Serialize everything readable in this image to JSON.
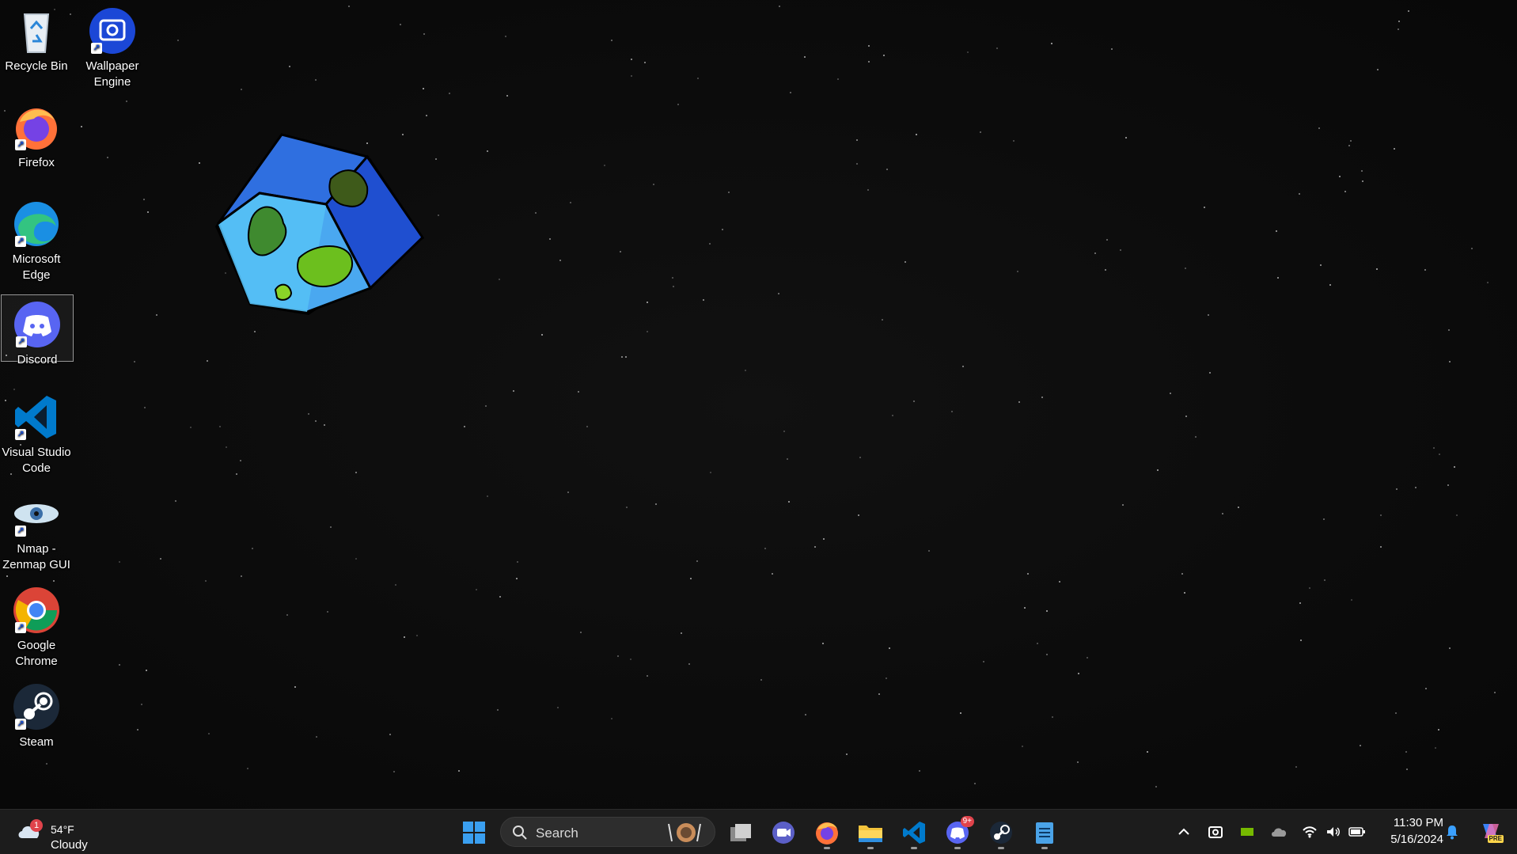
{
  "desktop": {
    "icons": [
      {
        "label": "Recycle Bin",
        "icon": "recycle-bin-icon"
      },
      {
        "label": "Wallpaper Engine",
        "icon": "wallpaper-engine-icon"
      },
      {
        "label": "Firefox",
        "icon": "firefox-icon"
      },
      {
        "label": "Microsoft Edge",
        "icon": "edge-icon"
      },
      {
        "label": "Discord",
        "icon": "discord-icon"
      },
      {
        "label": "Visual Studio Code",
        "icon": "vscode-icon"
      },
      {
        "label": "Nmap - Zenmap GUI",
        "icon": "zenmap-icon"
      },
      {
        "label": "Google Chrome",
        "icon": "chrome-icon"
      },
      {
        "label": "Steam",
        "icon": "steam-icon"
      }
    ],
    "selected_icon": "Discord",
    "wallpaper": "starfield with cube-shaped planet"
  },
  "taskbar": {
    "weather": {
      "temp": "54°F",
      "condition": "Cloudy",
      "badge": "1"
    },
    "search": {
      "placeholder": "Search"
    },
    "pinned": [
      {
        "name": "start",
        "icon": "windows-logo-icon"
      },
      {
        "name": "task-view",
        "icon": "task-view-icon"
      },
      {
        "name": "teams-meet",
        "icon": "camera-chat-icon"
      },
      {
        "name": "firefox",
        "icon": "firefox-icon",
        "running": true
      },
      {
        "name": "file-explorer",
        "icon": "folder-icon",
        "running": true
      },
      {
        "name": "vscode",
        "icon": "vscode-icon",
        "running": true
      },
      {
        "name": "discord",
        "icon": "discord-icon",
        "running": true,
        "badge": "9+"
      },
      {
        "name": "steam",
        "icon": "steam-icon",
        "running": true
      },
      {
        "name": "notepad",
        "icon": "notepad-icon",
        "running": true
      }
    ],
    "tray": {
      "icons": [
        "chevron-up-icon",
        "screenshot-icon",
        "nvidia-icon",
        "onedrive-icon",
        "wifi-icon",
        "volume-icon",
        "battery-icon"
      ],
      "time": "11:30 PM",
      "date": "5/16/2024",
      "notification_icon": "bell-icon",
      "copilot_badge": "PRE"
    }
  },
  "colors": {
    "taskbar_bg": "#1c1c1c",
    "desktop_bg": "#0b0b0b",
    "accent": "#0078d4"
  }
}
